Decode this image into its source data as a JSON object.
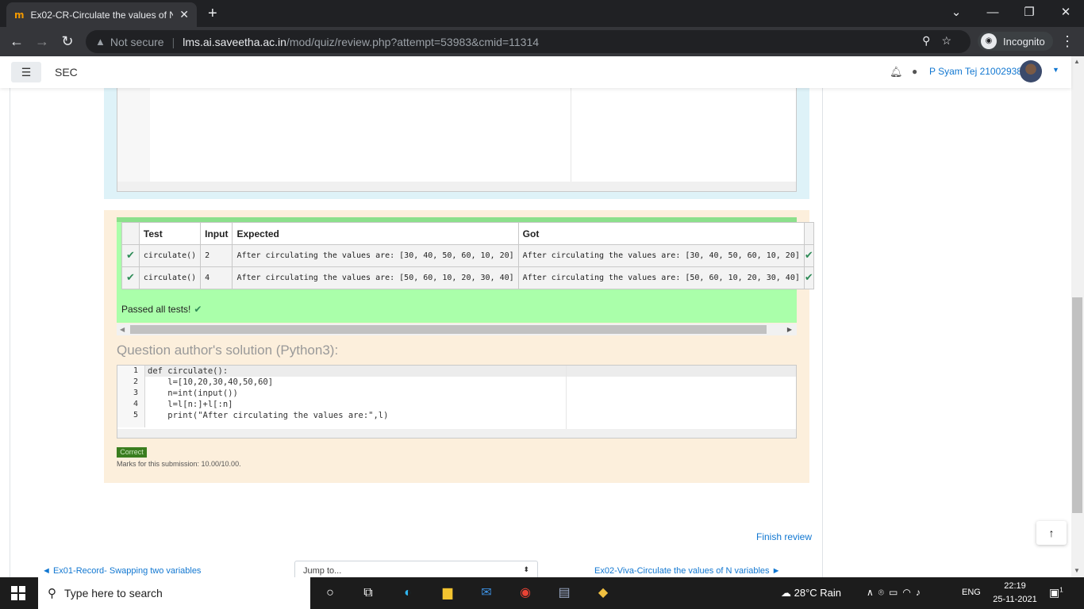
{
  "browser": {
    "tab_title": "Ex02-CR-Circulate the values of N",
    "tab_favicon": "m",
    "new_tab": "+",
    "not_secure": "Not secure",
    "url_host": "lms.ai.saveetha.ac.in",
    "url_path": "/mod/quiz/review.php?attempt=53983&cmid=11314",
    "incognito": "Incognito"
  },
  "site": {
    "brand": "SEC",
    "user_name": "P Syam Tej 21002938"
  },
  "results": {
    "headers": [
      "Test",
      "Input",
      "Expected",
      "Got"
    ],
    "rows": [
      {
        "test": "circulate()",
        "input": "2",
        "expected": "After circulating the values are: [30, 40, 50, 60, 10, 20]",
        "got": "After circulating the values are: [30, 40, 50, 60, 10, 20]"
      },
      {
        "test": "circulate()",
        "input": "4",
        "expected": "After circulating the values are: [50, 60, 10, 20, 30, 40]",
        "got": "After circulating the values are: [50, 60, 10, 20, 30, 40]"
      }
    ],
    "passed": "Passed all tests!"
  },
  "solution": {
    "heading": "Question author's solution (Python3):",
    "line_numbers": [
      "1",
      "2",
      "3",
      "4",
      "5"
    ],
    "lines": [
      "def circulate():",
      "    l=[10,20,30,40,50,60]",
      "    n=int(input())",
      "    l=l[n:]+l[:n]",
      "    print(\"After circulating the values are:\",l)"
    ]
  },
  "grading": {
    "badge": "Correct",
    "marks": "Marks for this submission: 10.00/10.00."
  },
  "footer_nav": {
    "finish_review": "Finish review",
    "prev_link": "Ex01-Record- Swapping two variables",
    "jump_placeholder": "Jump to...",
    "next_link": "Ex02-Viva-Circulate the values of N variables"
  },
  "taskbar": {
    "search_placeholder": "Type here to search",
    "weather": "28°C  Rain",
    "language": "ENG",
    "time": "22:19",
    "date": "25-11-2021",
    "notification_count": "1"
  },
  "colors": {
    "pass_green": "#aaffaa",
    "feedback_bg": "#fcefdc",
    "answer_bg": "#def2f8",
    "link_blue": "#1177d1"
  }
}
